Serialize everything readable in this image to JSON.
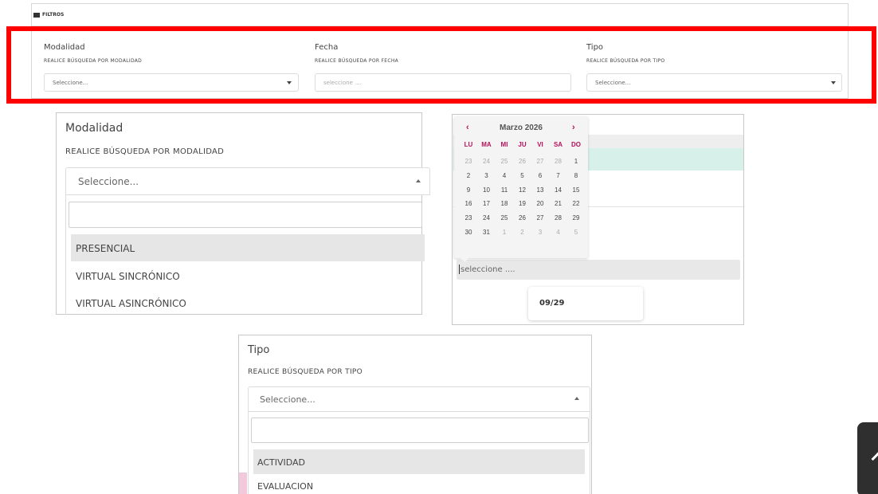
{
  "filters_panel": {
    "header": "FILTROS",
    "fields": [
      {
        "label": "Modalidad",
        "caption": "REALICE BÚSQUEDA POR MODALIDAD",
        "placeholder": "Seleccione..."
      },
      {
        "label": "Fecha",
        "caption": "REALICE BÚSQUEDA POR FECHA",
        "placeholder": "seleccione ...."
      },
      {
        "label": "Tipo",
        "caption": "REALICE BÚSQUEDA POR TIPO",
        "placeholder": "Seleccione..."
      }
    ]
  },
  "modalidad_dropdown": {
    "label": "Modalidad",
    "caption": "REALICE BÚSQUEDA POR MODALIDAD",
    "placeholder": "Seleccione...",
    "options": [
      "PRESENCIAL",
      "VIRTUAL SINCRÓNICO",
      "VIRTUAL ASINCRÓNICO"
    ]
  },
  "fecha_picker": {
    "month": "Marzo 2026",
    "prev": "‹",
    "next": "›",
    "weekdays": [
      "LU",
      "MA",
      "MI",
      "JU",
      "VI",
      "SA",
      "DO"
    ],
    "weeks": [
      [
        "23",
        "24",
        "25",
        "26",
        "27",
        "28",
        "1"
      ],
      [
        "2",
        "3",
        "4",
        "5",
        "6",
        "7",
        "8"
      ],
      [
        "9",
        "10",
        "11",
        "12",
        "13",
        "14",
        "15"
      ],
      [
        "16",
        "17",
        "18",
        "19",
        "20",
        "21",
        "22"
      ],
      [
        "23",
        "24",
        "25",
        "26",
        "27",
        "28",
        "29"
      ],
      [
        "30",
        "31",
        "1",
        "2",
        "3",
        "4",
        "5"
      ]
    ],
    "input_placeholder": "seleccione ....",
    "tooltip": "09/29"
  },
  "tipo_dropdown": {
    "label": "Tipo",
    "caption": "REALICE BÚSQUEDA POR TIPO",
    "placeholder": "Seleccione...",
    "options": [
      "ACTIVIDAD",
      "EVALUACION"
    ]
  },
  "colors": {
    "highlight_border": "#ff0000",
    "calendar_accent": "#b8105a",
    "selected_row": "#e6e6e6",
    "teal_row": "#d7f1ea"
  }
}
